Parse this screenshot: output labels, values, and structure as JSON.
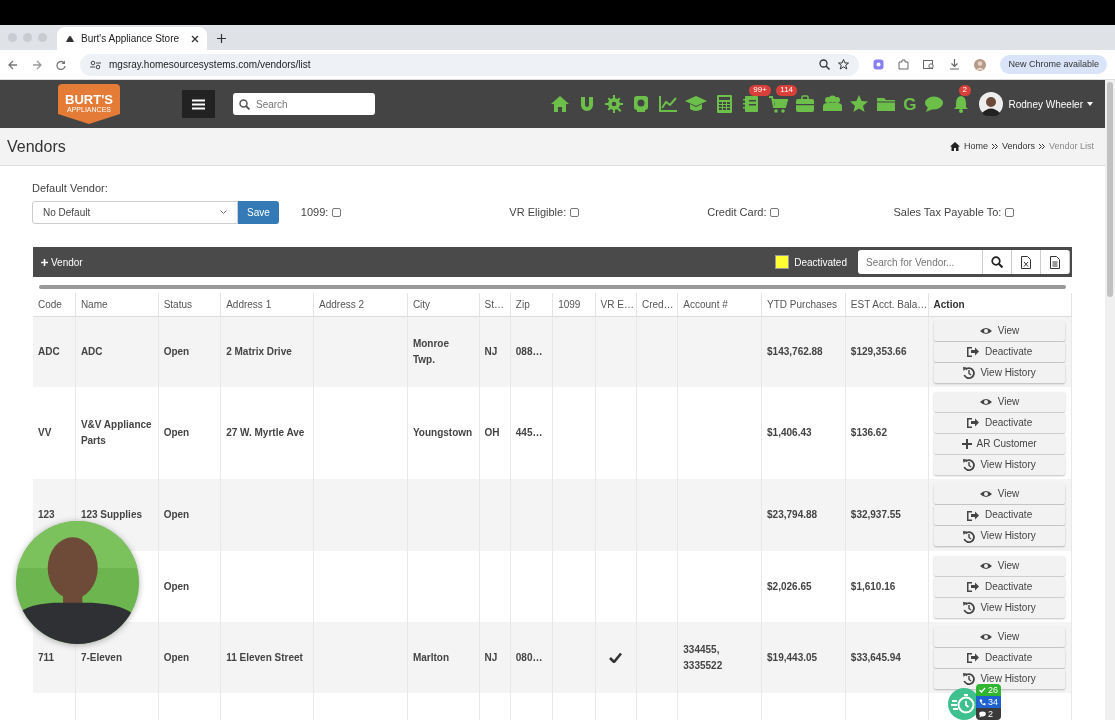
{
  "browser": {
    "tab_title": "Burt's Appliance Store",
    "url": "mgsray.homesourcesystems.com/vendors/list",
    "update_button": "New Chrome available"
  },
  "app": {
    "logo": {
      "title": "BURT'S",
      "subtitle": "APPLIANCES"
    },
    "search_placeholder": "Search",
    "nav_icons": [
      {
        "kind": "home"
      },
      {
        "kind": "magnet"
      },
      {
        "kind": "gear"
      },
      {
        "kind": "webcam"
      },
      {
        "kind": "chart"
      },
      {
        "kind": "cap"
      },
      {
        "kind": "calculator"
      },
      {
        "kind": "notebook",
        "badge": "99+"
      },
      {
        "kind": "cart",
        "badge": "114"
      },
      {
        "kind": "briefcase"
      },
      {
        "kind": "users"
      },
      {
        "kind": "star"
      },
      {
        "kind": "folder"
      },
      {
        "kind": "letter",
        "label": "G"
      },
      {
        "kind": "chat"
      },
      {
        "kind": "bell",
        "badge": "2"
      }
    ],
    "user": "Rodney Wheeler"
  },
  "page": {
    "title": "Vendors",
    "breadcrumbs": [
      {
        "label": "Home",
        "current": false
      },
      {
        "label": "Vendors",
        "current": false
      },
      {
        "label": "Vendor List",
        "current": true
      }
    ]
  },
  "filters": {
    "default_vendor_label": "Default Vendor:",
    "default_vendor_value": "No Default",
    "save_button": "Save",
    "checkboxes": [
      {
        "label": "1099:",
        "checked": false
      },
      {
        "label": "VR Eligible:",
        "checked": false
      },
      {
        "label": "Credit Card:",
        "checked": false
      },
      {
        "label": "Sales Tax Payable To:",
        "checked": false
      }
    ]
  },
  "toolbar": {
    "add_button": "Vendor",
    "legend": {
      "label": "Deactivated",
      "color": "#ffff33"
    },
    "search_placeholder": "Search for Vendor..."
  },
  "table": {
    "columns": [
      "Code",
      "Name",
      "Status",
      "Address 1",
      "Address 2",
      "City",
      "St…",
      "Zip",
      "1099",
      "VR E…",
      "Cred…",
      "Account #",
      "YTD Purchases",
      "EST Acct. Bala…",
      "Action"
    ],
    "rows": [
      {
        "code": "ADC",
        "name": "ADC",
        "status": "Open",
        "address_1": "2 Matrix Drive",
        "city": "Monroe Twp.",
        "state": "NJ",
        "zip": "088…",
        "vr_eligible": false,
        "ytd": "$143,762.88",
        "est": "$129,353.66",
        "actions": [
          {
            "kind": "view",
            "label": "View"
          },
          {
            "kind": "deactivate",
            "label": "Deactivate"
          },
          {
            "kind": "history",
            "label": "View History"
          }
        ]
      },
      {
        "code": "VV",
        "name": "V&V Appliance Parts",
        "status": "Open",
        "address_1": "27 W. Myrtle Ave",
        "city": "Youngstown",
        "state": "OH",
        "zip": "445…",
        "vr_eligible": false,
        "ytd": "$1,406.43",
        "est": "$136.62",
        "actions": [
          {
            "kind": "view",
            "label": "View"
          },
          {
            "kind": "deactivate",
            "label": "Deactivate"
          },
          {
            "kind": "add",
            "label": "AR Customer"
          },
          {
            "kind": "history",
            "label": "View History"
          }
        ]
      },
      {
        "code": "123",
        "name": "123 Supplies",
        "status": "Open",
        "vr_eligible": false,
        "ytd": "$23,794.88",
        "est": "$32,937.55",
        "actions": [
          {
            "kind": "view",
            "label": "View"
          },
          {
            "kind": "deactivate",
            "label": "Deactivate"
          },
          {
            "kind": "history",
            "label": "View History"
          }
        ]
      },
      {
        "status": "Open",
        "vr_eligible": false,
        "ytd": "$2,026.65",
        "est": "$1,610.16",
        "actions": [
          {
            "kind": "view",
            "label": "View"
          },
          {
            "kind": "deactivate",
            "label": "Deactivate"
          },
          {
            "kind": "history",
            "label": "View History"
          }
        ]
      },
      {
        "code": "711",
        "name": "7-Eleven",
        "status": "Open",
        "address_1": "11 Eleven Street",
        "city": "Marlton",
        "state": "NJ",
        "zip": "080…",
        "vr_eligible": true,
        "account": "334455, 3335522",
        "ytd": "$19,443.05",
        "est": "$33,645.94",
        "actions": [
          {
            "kind": "view",
            "label": "View"
          },
          {
            "kind": "deactivate",
            "label": "Deactivate"
          },
          {
            "kind": "history",
            "label": "View History"
          }
        ]
      }
    ]
  },
  "floating_widget": {
    "counts": [
      {
        "kind": "tasks",
        "label": "26",
        "color": "#2fb52f"
      },
      {
        "kind": "calls",
        "label": "34",
        "color": "#1f63d0"
      },
      {
        "kind": "messages",
        "label": "2",
        "color": "#3a3a3a"
      }
    ]
  }
}
